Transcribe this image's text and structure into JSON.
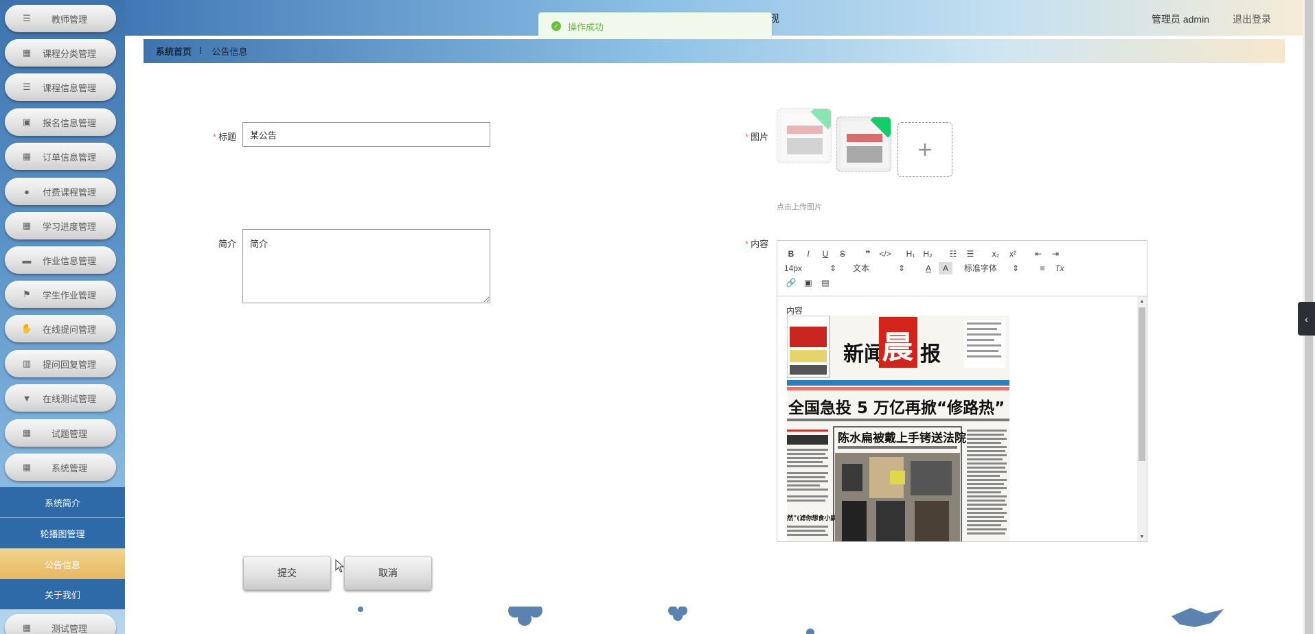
{
  "sidebar": {
    "menu": [
      {
        "label": "教师管理",
        "icon": "list-icon"
      },
      {
        "label": "课程分类管理",
        "icon": "grid-icon"
      },
      {
        "label": "课程信息管理",
        "icon": "list-icon"
      },
      {
        "label": "报名信息管理",
        "icon": "clipboard-icon"
      },
      {
        "label": "订单信息管理",
        "icon": "grid-icon"
      },
      {
        "label": "付费课程管理",
        "icon": "user-icon"
      },
      {
        "label": "学习进度管理",
        "icon": "grid-icon"
      },
      {
        "label": "作业信息管理",
        "icon": "monitor-icon"
      },
      {
        "label": "学生作业管理",
        "icon": "flag-icon"
      },
      {
        "label": "在线提问管理",
        "icon": "thumb-icon"
      },
      {
        "label": "提问回复管理",
        "icon": "bar-chart-icon"
      },
      {
        "label": "在线测试管理",
        "icon": "pin-icon"
      },
      {
        "label": "试题管理",
        "icon": "grid-icon"
      },
      {
        "label": "系统管理",
        "icon": "grid-icon"
      }
    ],
    "sub_items": [
      "系统简介",
      "轮播图管理",
      "公告信息",
      "关于我们"
    ],
    "bottom_menu": {
      "label": "测试管理",
      "icon": "apps-icon"
    }
  },
  "header": {
    "title_fragment": "现",
    "admin": "管理员 admin",
    "logout": "退出登录"
  },
  "toast": {
    "message": "操作成功"
  },
  "breadcrumb": {
    "home": "系统首页",
    "separator": "⠇",
    "current": "公告信息"
  },
  "form": {
    "title_label": "标题",
    "title_value": "某公告",
    "intro_label": "简介",
    "intro_value": "简介",
    "image_label": "图片",
    "upload_tip": "点击上传图片",
    "content_label": "内容"
  },
  "editor": {
    "font_size": "14px",
    "text_type": "文本",
    "font_family": "标准字体",
    "body_text": "内容"
  },
  "newspaper": {
    "masthead_left": "新闻",
    "masthead_red": "晨",
    "masthead_right": "报",
    "headline": "全国急投 5 万亿再掀“修路热”",
    "subhead": "陈水扁被戴上手铐送法院",
    "side_head": "然”(滤你想食小康根数子行不通"
  },
  "buttons": {
    "submit": "提交",
    "cancel": "取消"
  }
}
